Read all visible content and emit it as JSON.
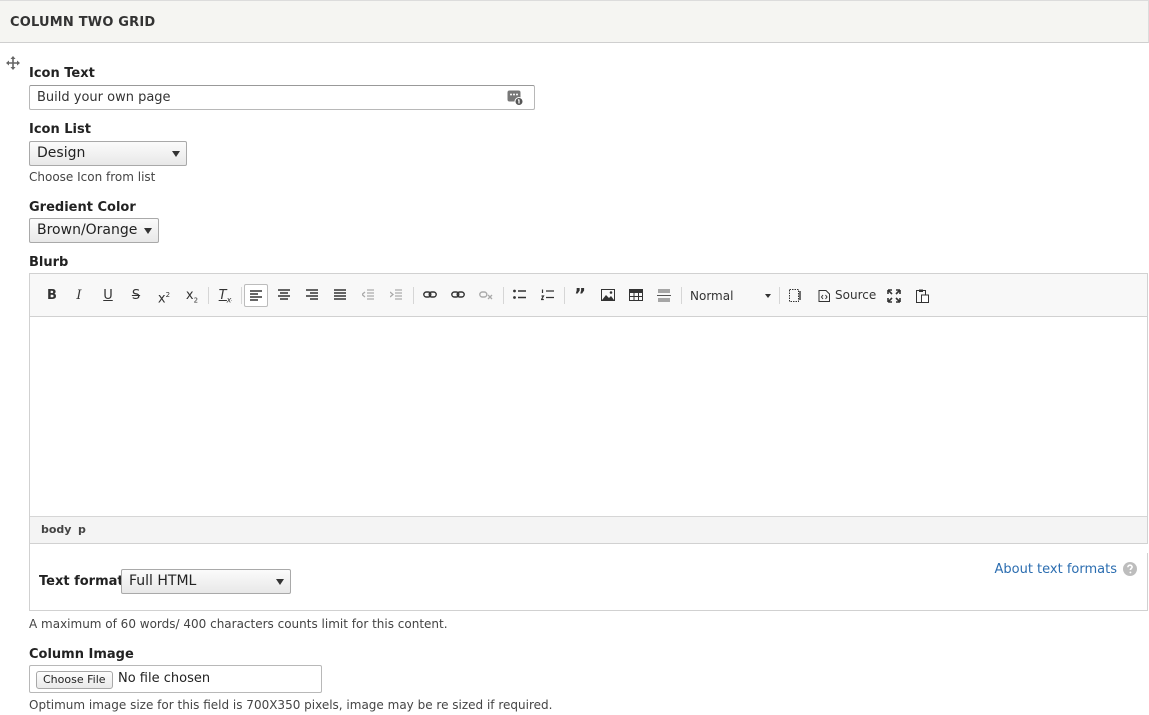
{
  "section": {
    "title": "COLUMN TWO GRID"
  },
  "icon_text": {
    "label": "Icon Text",
    "value": "Build your own page"
  },
  "icon_list": {
    "label": "Icon List",
    "selected": "Design",
    "description": "Choose Icon from list"
  },
  "gradient_color": {
    "label": "Gredient Color",
    "selected": "Brown/Orange"
  },
  "blurb": {
    "label": "Blurb",
    "toolbar": {
      "format_value": "Normal",
      "source_label": "Source"
    },
    "path": [
      "body",
      "p"
    ],
    "text_format_label": "Text format",
    "text_format_selected": "Full HTML",
    "about_link": "About text formats",
    "description": "A maximum of 60 words/ 400 characters counts limit for this content."
  },
  "column_image": {
    "label": "Column Image",
    "button_label": "Choose File",
    "status": "No file chosen",
    "description": "Optimum image size for this field is 700X350 pixels, image may be re sized if required."
  },
  "colors": {
    "link": "#2b6db0",
    "header_bg": "#f5f5f2"
  }
}
